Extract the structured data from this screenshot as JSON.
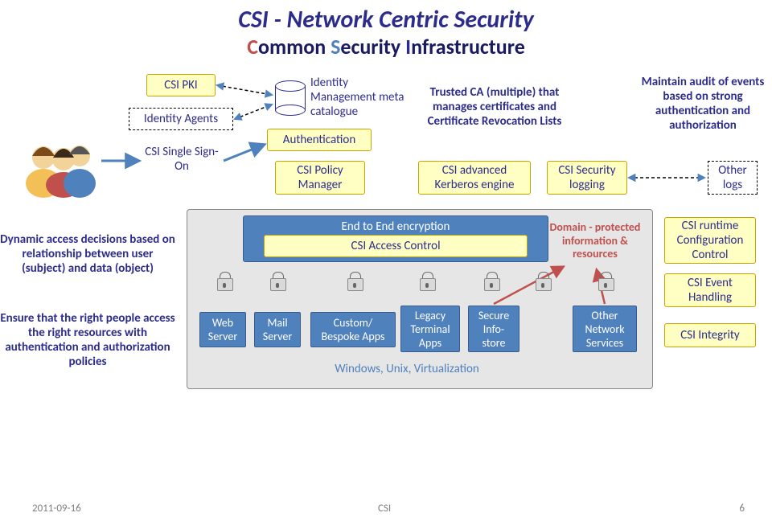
{
  "title": "CSI - Network Centric Security",
  "subtitle": {
    "c": "C",
    "c2": "ommon ",
    "s": "S",
    "s2": "ecurity ",
    "i": "I",
    "i2": "nfrastructure"
  },
  "boxes": {
    "csi_pki": "CSI PKI",
    "identity_agents": "Identity Agents",
    "sso": "CSI Single Sign-On",
    "idm": "Identity Management meta catalogue",
    "auth": "Authentication",
    "policy": "CSI Policy Manager",
    "trusted_ca": "Trusted CA (multiple) that manages certificates and Certificate Revocation Lists",
    "kerberos": "CSI advanced Kerberos engine",
    "sec_log": "CSI Security logging",
    "audit": "Maintain audit of events based on strong authentication and authorization",
    "other_logs": "Other logs",
    "e2e": "End to End encryption",
    "access_ctl": "CSI Access Control",
    "domain": "Domain - protected information & resources",
    "runtime": "CSI runtime Configuration Control",
    "event": "CSI Event Handling",
    "integrity": "CSI Integrity",
    "dyn": "Dynamic access decisions based on relationship between user (subject) and data (object)",
    "ensure": "Ensure that the right people access the right resources with authentication and authorization policies",
    "web": "Web Server",
    "mail": "Mail Server",
    "custom": "Custom/ Bespoke Apps",
    "legacy": "Legacy Terminal Apps",
    "secure": "Secure Info-store",
    "other_net": "Other Network Services",
    "platform": "Windows, Unix, Virtualization"
  },
  "footer": {
    "date": "2011-09-16",
    "center": "CSI",
    "page": "6"
  }
}
